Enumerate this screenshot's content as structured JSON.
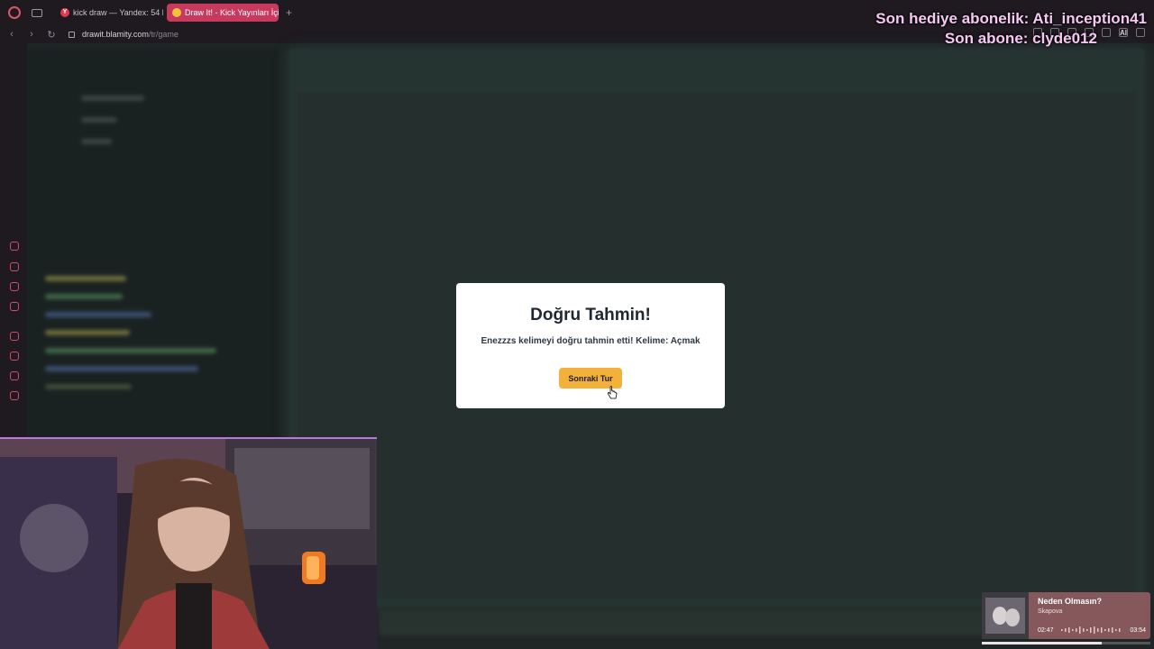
{
  "browser": {
    "tabs": [
      {
        "label": "kick draw — Yandex: 54 b",
        "favicon": "Y",
        "active": false
      },
      {
        "label": "Draw It! - Kick Yayınları İçi",
        "favicon": "",
        "active": true
      }
    ],
    "new_tab": "+",
    "url_host": "drawit.blamity.com",
    "url_path": "/tr/game",
    "ai_label": "AI"
  },
  "modal": {
    "title": "Doğru Tahmin!",
    "message": "Enezzzs kelimeyi doğru tahmin etti! Kelime: Açmak",
    "button": "Sonraki Tur"
  },
  "overlay": {
    "last_gift_sub": "Son hediye abonelik: Ati_inception41",
    "last_sub": "Son abone: clyde012"
  },
  "now_playing": {
    "title": "Neden Olmasın?",
    "artist": "Skapova",
    "current_time": "02:47",
    "total_time": "03:54",
    "progress": 0.71
  },
  "colors": {
    "accent": "#c73a5e",
    "button": "#f2b13b",
    "overlay_text": "#f6c8f3"
  }
}
